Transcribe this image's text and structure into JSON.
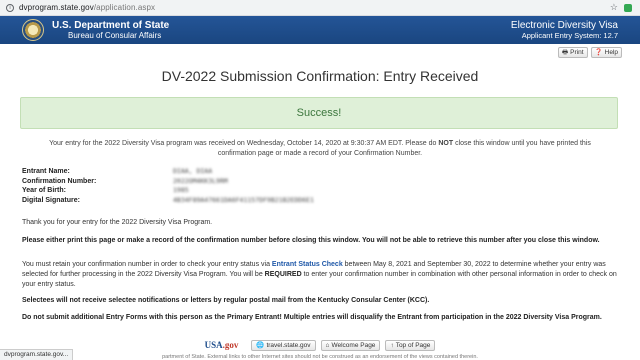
{
  "browser": {
    "url_host": "dvprogram.state.gov",
    "url_path": "/application.aspx",
    "status_text": "dvprogram.state.gov..."
  },
  "header": {
    "agency_line1": "U.S. Department of State",
    "agency_line2": "Bureau of Consular Affairs",
    "system_line1": "Electronic Diversity Visa",
    "system_line2": "Applicant Entry System: 12.7"
  },
  "tools": {
    "print": "Print",
    "help": "Help"
  },
  "page_title": "DV-2022 Submission Confirmation: Entry Received",
  "success_label": "Success!",
  "intro": {
    "before": "Your entry for the 2022 Diversity Visa program was received on Wednesday, October 14, 2020 at 9:30:37 AM EDT. Please do ",
    "bold": "NOT",
    "after": " close this window until you have printed this confirmation page or made a record of your Confirmation Number."
  },
  "details": [
    {
      "label": "Entrant Name:",
      "value": "DIAA, DIAA"
    },
    {
      "label": "Confirmation Number:",
      "value": "2022OM4KK3L9RM"
    },
    {
      "label": "Year of Birth:",
      "value": "1985"
    },
    {
      "label": "Digital Signature:",
      "value": "4B34F89A47661DA6F41157DF9B21B2EDD6E1"
    }
  ],
  "thanks": "Thank you for your entry for the 2022 Diversity Visa Program.",
  "warning_print": "Please either print this page or make a record of the confirmation number before closing this window. You will not be able to retrieve this number after you close this window.",
  "retain": {
    "before": "You must retain your confirmation number in order to check your entry status via ",
    "link": "Entrant Status Check",
    "middle": " between May 8, 2021 and September 30, 2022 to determine whether your entry was selected for further processing in the 2022 Diversity Visa Program. You will be ",
    "bold": "REQUIRED",
    "after": " to enter your confirmation number in combination with other personal information in order to check on your entry status."
  },
  "selectees_note": "Selectees will not receive selectee notifications or letters by regular postal mail from the Kentucky Consular Center (KCC).",
  "duplicate_note": "Do not submit additional Entry Forms with this person as the Primary Entrant! Multiple entries will disqualify the Entrant from participation in the 2022 Diversity Visa Program.",
  "footer": {
    "usagov": "USA",
    "usagov_suffix": ".gov",
    "travel": "travel.state.gov",
    "welcome": "Welcome Page",
    "top": "Top of Page",
    "disclaimer": "partment of State. External links to other Internet sites should not be construed as an endorsement of the views contained therein."
  }
}
